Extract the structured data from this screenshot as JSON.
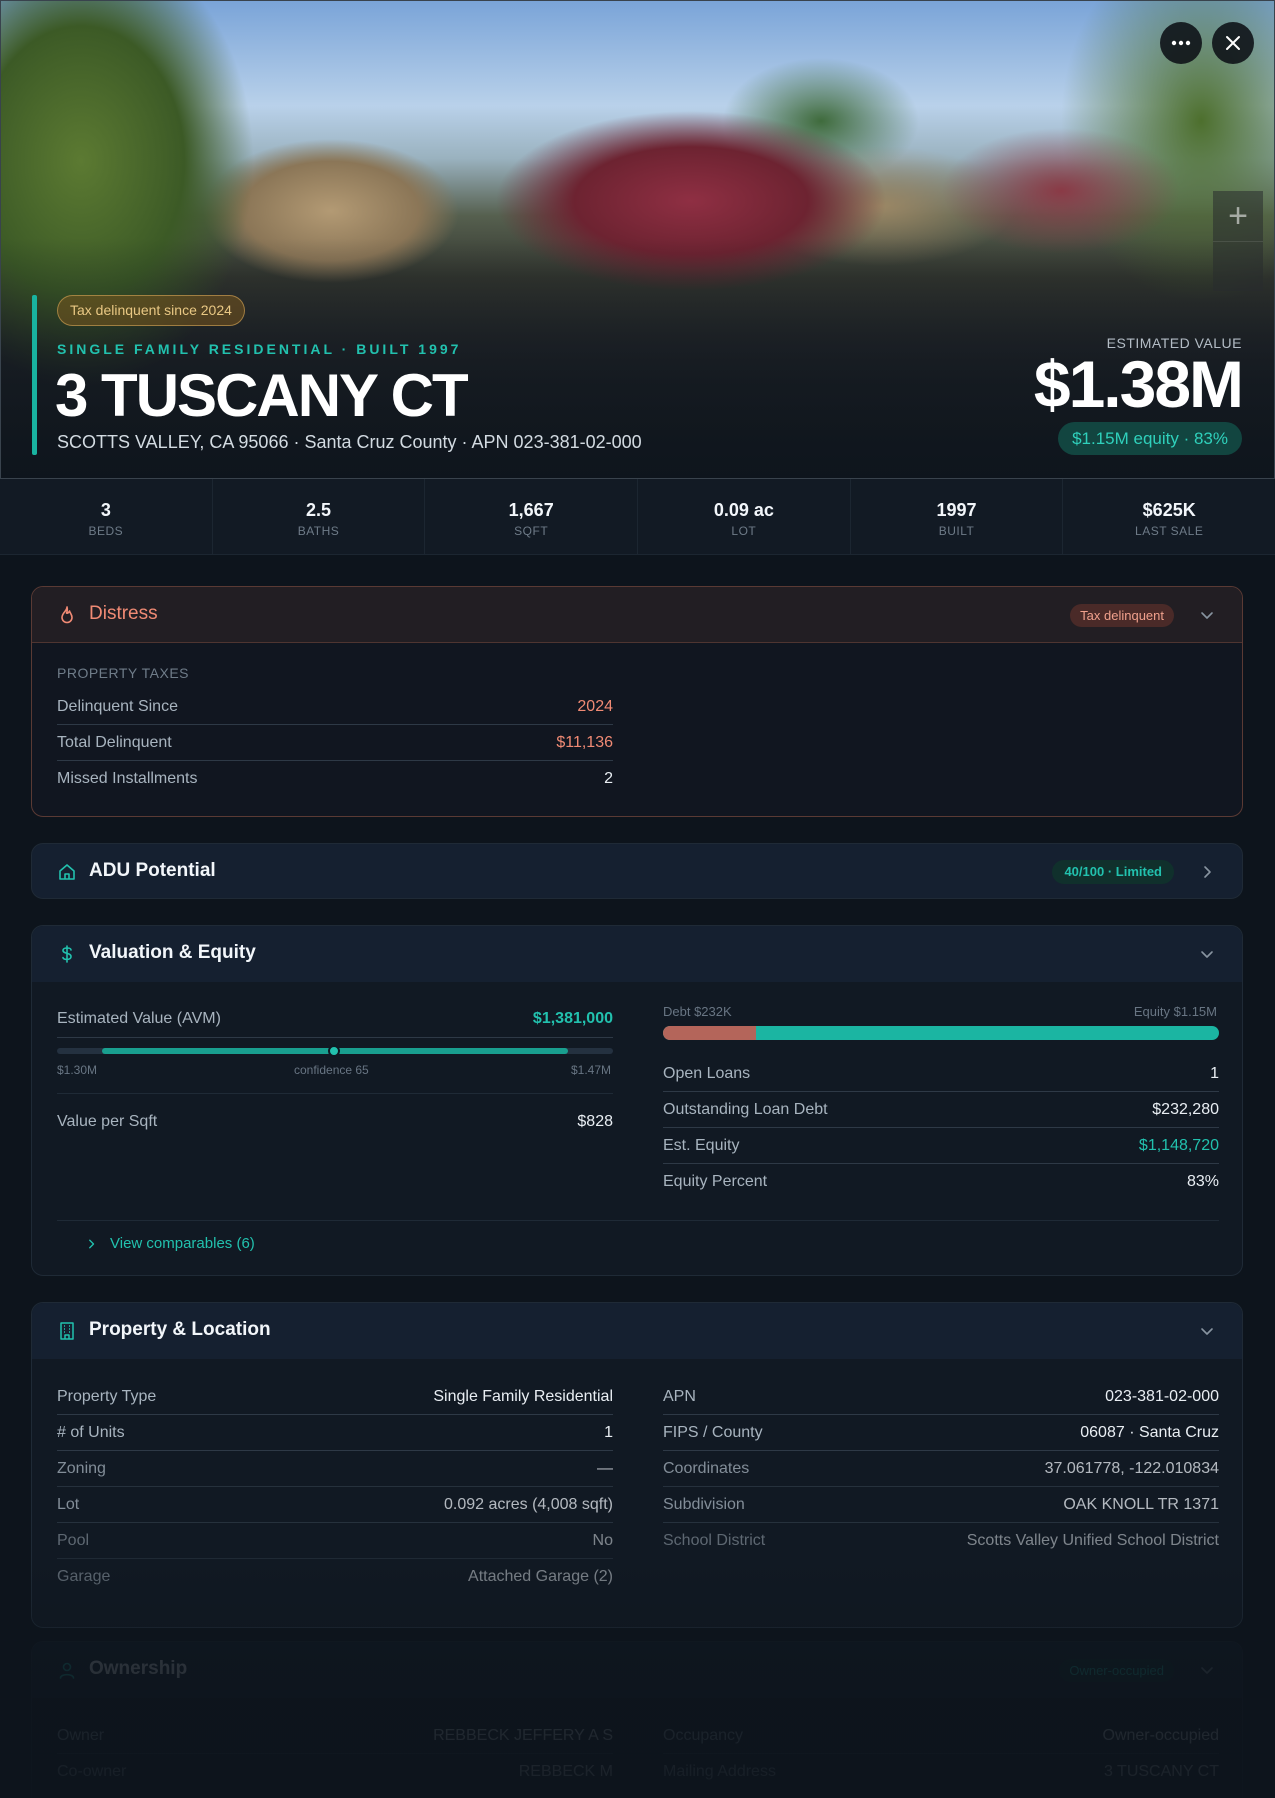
{
  "hero": {
    "tax_badge": "Tax delinquent since 2024",
    "subtitle": "SINGLE FAMILY RESIDENTIAL · BUILT 1997",
    "title": "3 TUSCANY CT",
    "address": "SCOTTS VALLEY, CA 95066 · Santa Cruz County · APN 023-381-02-000",
    "estimated_label": "ESTIMATED VALUE",
    "estimated_value": "$1.38M",
    "equity_pill": "$1.15M equity · 83%",
    "icons": {
      "more": "more-horizontal-icon",
      "close": "close-icon",
      "zoom": "plus-icon"
    }
  },
  "stats": [
    {
      "value": "3",
      "label": "BEDS"
    },
    {
      "value": "2.5",
      "label": "BATHS"
    },
    {
      "value": "1,667",
      "label": "SQFT"
    },
    {
      "value": "0.09 ac",
      "label": "LOT"
    },
    {
      "value": "1997",
      "label": "BUILT"
    },
    {
      "value": "$625K",
      "label": "LAST SALE"
    }
  ],
  "distress": {
    "title": "Distress",
    "badge": "Tax delinquent",
    "section_label": "PROPERTY TAXES",
    "rows": [
      {
        "label": "Delinquent Since",
        "value": "2024"
      },
      {
        "label": "Total Delinquent",
        "value": "$11,136"
      },
      {
        "label": "Missed Installments",
        "value": "2"
      }
    ]
  },
  "adu": {
    "title": "ADU Potential",
    "badge": "40/100 · Limited",
    "score": 40
  },
  "valuation": {
    "title": "Valuation & Equity",
    "avm_label": "Estimated Value (AVM)",
    "avm_value": "$1,381,000",
    "range_low": "$1.30M",
    "range_high": "$1.47M",
    "confidence": "confidence 65",
    "per_sqft_label": "Value per Sqft",
    "per_sqft_value": "$828",
    "debt_label": "Debt $232K",
    "equity_label": "Equity $1.15M",
    "debt_fraction": 0.168,
    "rows": [
      {
        "label": "Open Loans",
        "value": "1"
      },
      {
        "label": "Outstanding Loan Debt",
        "value": "$232,280"
      },
      {
        "label": "Est. Equity",
        "value": "$1,148,720"
      },
      {
        "label": "Equity Percent",
        "value": "83%"
      }
    ],
    "comps_link": "View comparables (6)"
  },
  "property": {
    "title": "Property & Location",
    "left": [
      {
        "label": "Property Type",
        "value": "Single Family Residential"
      },
      {
        "label": "# of Units",
        "value": "1"
      },
      {
        "label": "Zoning",
        "value": "—"
      },
      {
        "label": "Lot",
        "value": "0.092 acres (4,008 sqft)"
      },
      {
        "label": "Pool",
        "value": "No"
      },
      {
        "label": "Garage",
        "value": "Attached Garage (2)"
      }
    ],
    "right": [
      {
        "label": "APN",
        "value": "023-381-02-000"
      },
      {
        "label": "FIPS / County",
        "value": "06087 · Santa Cruz"
      },
      {
        "label": "Coordinates",
        "value": "37.061778, -122.010834"
      },
      {
        "label": "Subdivision",
        "value": "OAK KNOLL TR 1371"
      },
      {
        "label": "School District",
        "value": "Scotts Valley Unified School District"
      }
    ]
  },
  "ownership": {
    "title": "Ownership",
    "badge": "Owner-occupied",
    "left": [
      {
        "label": "Owner",
        "value": "REBBECK JEFFERY A S"
      },
      {
        "label": "Co-owner",
        "value": "REBBECK M"
      }
    ],
    "right": [
      {
        "label": "Occupancy",
        "value": "Owner-occupied"
      },
      {
        "label": "Mailing Address",
        "value": "3 TUSCANY CT"
      }
    ]
  },
  "colors": {
    "accent": "#22c1ae",
    "danger": "#f08a74",
    "warning": "#e9c884",
    "background": "#0d141c"
  }
}
